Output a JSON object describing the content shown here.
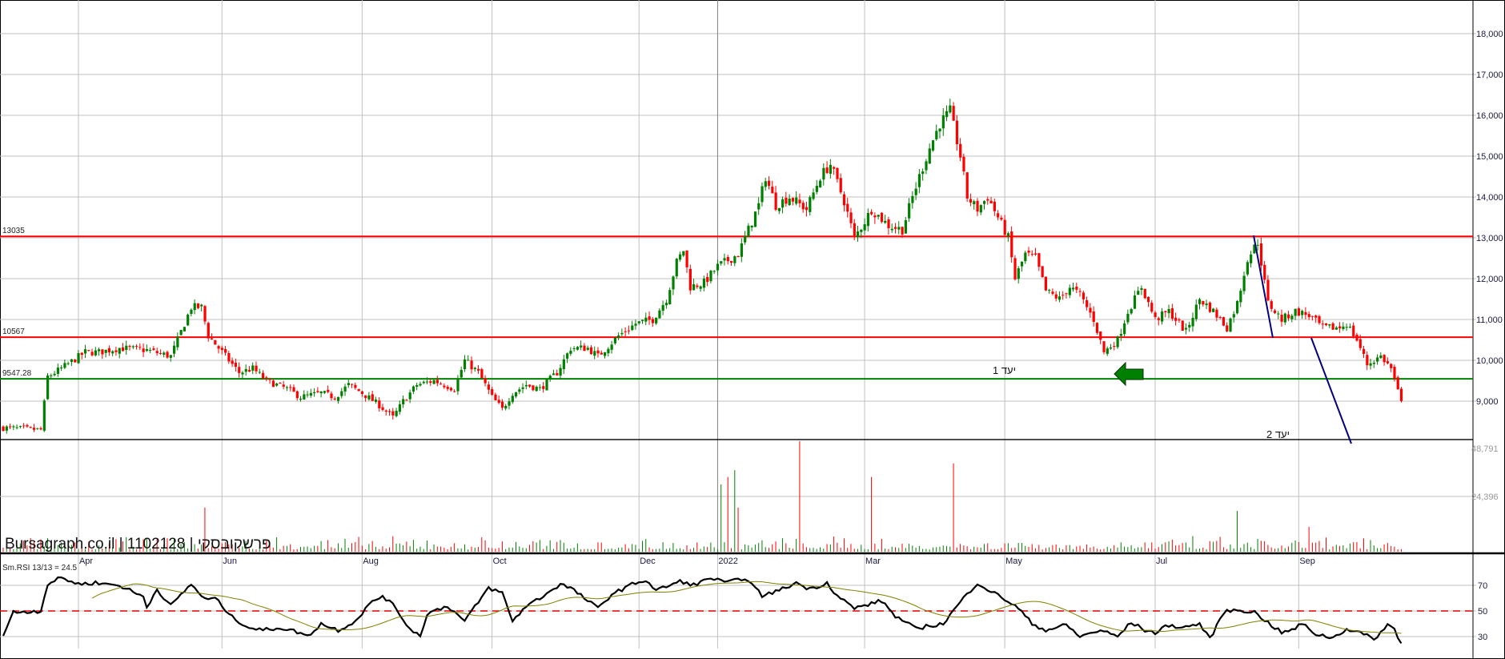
{
  "watermark": "Bursagraph.co.il | 1102128 | פרשקובסקי",
  "chart_data": [
    {
      "type": "candlestick",
      "title": "פרשקובסקי 1102128",
      "ylim": [
        8000,
        18500
      ],
      "grid": true,
      "y_ticks": [
        9000,
        10000,
        11000,
        12000,
        13000,
        14000,
        15000,
        16000,
        17000,
        18000
      ],
      "y_tick_labels": [
        "9,000",
        "10,000",
        "11,000",
        "12,000",
        "13,000",
        "14,000",
        "15,000",
        "16,000",
        "17,000",
        "18,000"
      ],
      "x_tick_labels": [
        "Apr",
        "Jun",
        "Aug",
        "Oct",
        "Dec",
        "2022",
        "Mar",
        "May",
        "Jul",
        "Sep"
      ],
      "x_tick_bars": [
        22,
        64,
        105,
        143,
        186,
        209,
        252,
        293,
        337,
        379
      ],
      "bar_count": 410,
      "close_keypoints": [
        [
          0,
          8350
        ],
        [
          11,
          8300
        ],
        [
          13,
          9600
        ],
        [
          17,
          9800
        ],
        [
          24,
          10200
        ],
        [
          28,
          10200
        ],
        [
          34,
          10300
        ],
        [
          42,
          10250
        ],
        [
          49,
          10100
        ],
        [
          52,
          10700
        ],
        [
          55,
          11300
        ],
        [
          58,
          11300
        ],
        [
          60,
          10600
        ],
        [
          65,
          10100
        ],
        [
          69,
          9700
        ],
        [
          73,
          9800
        ],
        [
          77,
          9500
        ],
        [
          83,
          9300
        ],
        [
          87,
          9100
        ],
        [
          93,
          9200
        ],
        [
          97,
          9100
        ],
        [
          101,
          9400
        ],
        [
          105,
          9200
        ],
        [
          110,
          8900
        ],
        [
          114,
          8600
        ],
        [
          117,
          9000
        ],
        [
          121,
          9400
        ],
        [
          126,
          9500
        ],
        [
          132,
          9300
        ],
        [
          135,
          10000
        ],
        [
          139,
          9700
        ],
        [
          143,
          9100
        ],
        [
          146,
          8800
        ],
        [
          149,
          9200
        ],
        [
          153,
          9400
        ],
        [
          157,
          9300
        ],
        [
          162,
          9700
        ],
        [
          166,
          10300
        ],
        [
          171,
          10300
        ],
        [
          174,
          10100
        ],
        [
          180,
          10600
        ],
        [
          185,
          10900
        ],
        [
          190,
          11000
        ],
        [
          194,
          11500
        ],
        [
          197,
          12400
        ],
        [
          199,
          12700
        ],
        [
          201,
          11800
        ],
        [
          205,
          11900
        ],
        [
          209,
          12300
        ],
        [
          215,
          12600
        ],
        [
          218,
          13200
        ],
        [
          221,
          13800
        ],
        [
          223,
          14500
        ],
        [
          226,
          13800
        ],
        [
          230,
          14000
        ],
        [
          235,
          13700
        ],
        [
          239,
          14500
        ],
        [
          242,
          14800
        ],
        [
          246,
          13900
        ],
        [
          249,
          13000
        ],
        [
          252,
          13400
        ],
        [
          254,
          13700
        ],
        [
          259,
          13300
        ],
        [
          263,
          13200
        ],
        [
          266,
          14000
        ],
        [
          268,
          14500
        ],
        [
          271,
          15200
        ],
        [
          274,
          15800
        ],
        [
          277,
          16100
        ],
        [
          280,
          15000
        ],
        [
          282,
          14000
        ],
        [
          285,
          13700
        ],
        [
          288,
          14000
        ],
        [
          291,
          13500
        ],
        [
          294,
          13000
        ],
        [
          296,
          12000
        ],
        [
          299,
          12600
        ],
        [
          302,
          12500
        ],
        [
          305,
          11700
        ],
        [
          309,
          11500
        ],
        [
          312,
          11800
        ],
        [
          315,
          11600
        ],
        [
          319,
          11000
        ],
        [
          322,
          10200
        ],
        [
          326,
          10500
        ],
        [
          329,
          11200
        ],
        [
          333,
          11800
        ],
        [
          337,
          11000
        ],
        [
          341,
          11200
        ],
        [
          346,
          10700
        ],
        [
          350,
          11500
        ],
        [
          354,
          11200
        ],
        [
          358,
          10800
        ],
        [
          361,
          11400
        ],
        [
          364,
          12500
        ],
        [
          367,
          12900
        ],
        [
          370,
          11400
        ],
        [
          374,
          11000
        ],
        [
          378,
          11200
        ],
        [
          382,
          11100
        ],
        [
          386,
          10800
        ],
        [
          391,
          10800
        ],
        [
          393,
          10900
        ],
        [
          396,
          10500
        ],
        [
          399,
          9900
        ],
        [
          403,
          10100
        ],
        [
          406,
          9800
        ],
        [
          409,
          8950
        ]
      ],
      "levels": [
        {
          "label": "13035",
          "value": 13035,
          "color": "#ff0000"
        },
        {
          "label": "10567",
          "value": 10567,
          "color": "#ff0000"
        },
        {
          "label": "9547.28",
          "value": 9547.28,
          "color": "#008000"
        }
      ],
      "targets": [
        {
          "label": "יעד 1",
          "value": 9547.28
        },
        {
          "label": "יעד 2",
          "value": 8060
        }
      ],
      "colors": {
        "up": "#008000",
        "down": "#ff0000",
        "trendline": "#000080"
      }
    },
    {
      "type": "bar",
      "title": "Volume",
      "ylim": [
        0,
        48791
      ],
      "y_tick_labels": [
        "48,791",
        "24,396"
      ],
      "y_ticks": [
        48791,
        24396
      ],
      "baseline_range": [
        1000,
        5000
      ],
      "spikes": [
        [
          59,
          19500
        ],
        [
          210,
          29700
        ],
        [
          212,
          33000
        ],
        [
          214,
          36000
        ],
        [
          215,
          19500
        ],
        [
          233,
          48791
        ],
        [
          254,
          33000
        ],
        [
          278,
          39000
        ],
        [
          361,
          18000
        ],
        [
          382,
          11000
        ]
      ]
    },
    {
      "type": "line",
      "title": "Sm.RSI 13/13 = 24.5",
      "ylim": [
        20,
        85
      ],
      "y_ticks": [
        30,
        50,
        70
      ],
      "y_tick_labels": [
        "30",
        "50",
        "70"
      ],
      "reference_line": 50,
      "ma_period": 13,
      "rsi_keypoints": [
        [
          0,
          31
        ],
        [
          3,
          49
        ],
        [
          11,
          50
        ],
        [
          13,
          71
        ],
        [
          17,
          76
        ],
        [
          22,
          71
        ],
        [
          27,
          72
        ],
        [
          34,
          70
        ],
        [
          41,
          61
        ],
        [
          42,
          53
        ],
        [
          45,
          67
        ],
        [
          49,
          54
        ],
        [
          55,
          71
        ],
        [
          59,
          59
        ],
        [
          62,
          60
        ],
        [
          67,
          45
        ],
        [
          72,
          37
        ],
        [
          76,
          35
        ],
        [
          81,
          37
        ],
        [
          87,
          33
        ],
        [
          89,
          30
        ],
        [
          93,
          40
        ],
        [
          98,
          35
        ],
        [
          103,
          42
        ],
        [
          107,
          55
        ],
        [
          111,
          62
        ],
        [
          115,
          52
        ],
        [
          118,
          39
        ],
        [
          122,
          30
        ],
        [
          124,
          48
        ],
        [
          130,
          54
        ],
        [
          135,
          42
        ],
        [
          142,
          68
        ],
        [
          146,
          64
        ],
        [
          149,
          42
        ],
        [
          153,
          54
        ],
        [
          157,
          60
        ],
        [
          163,
          71
        ],
        [
          166,
          68
        ],
        [
          170,
          60
        ],
        [
          174,
          52
        ],
        [
          178,
          63
        ],
        [
          185,
          72
        ],
        [
          188,
          74
        ],
        [
          191,
          66
        ],
        [
          198,
          73
        ],
        [
          203,
          70
        ],
        [
          206,
          76
        ],
        [
          212,
          72
        ],
        [
          217,
          76
        ],
        [
          222,
          62
        ],
        [
          227,
          66
        ],
        [
          232,
          72
        ],
        [
          236,
          67
        ],
        [
          241,
          72
        ],
        [
          244,
          62
        ],
        [
          249,
          52
        ],
        [
          253,
          55
        ],
        [
          257,
          58
        ],
        [
          261,
          46
        ],
        [
          267,
          36
        ],
        [
          270,
          38
        ],
        [
          275,
          40
        ],
        [
          280,
          57
        ],
        [
          285,
          72
        ],
        [
          289,
          65
        ],
        [
          292,
          61
        ],
        [
          297,
          52
        ],
        [
          301,
          40
        ],
        [
          305,
          35
        ],
        [
          311,
          39
        ],
        [
          315,
          30
        ],
        [
          321,
          35
        ],
        [
          326,
          30
        ],
        [
          330,
          41
        ],
        [
          334,
          35
        ],
        [
          337,
          33
        ],
        [
          341,
          39
        ],
        [
          345,
          37
        ],
        [
          350,
          40
        ],
        [
          353,
          28
        ],
        [
          357,
          49
        ],
        [
          361,
          51
        ],
        [
          366,
          49
        ],
        [
          370,
          41
        ],
        [
          374,
          33
        ],
        [
          377,
          35
        ],
        [
          380,
          40
        ],
        [
          384,
          32
        ],
        [
          389,
          29
        ],
        [
          393,
          36
        ],
        [
          397,
          33
        ],
        [
          401,
          28
        ],
        [
          405,
          39
        ],
        [
          407,
          36
        ],
        [
          409,
          24.5
        ]
      ]
    }
  ]
}
